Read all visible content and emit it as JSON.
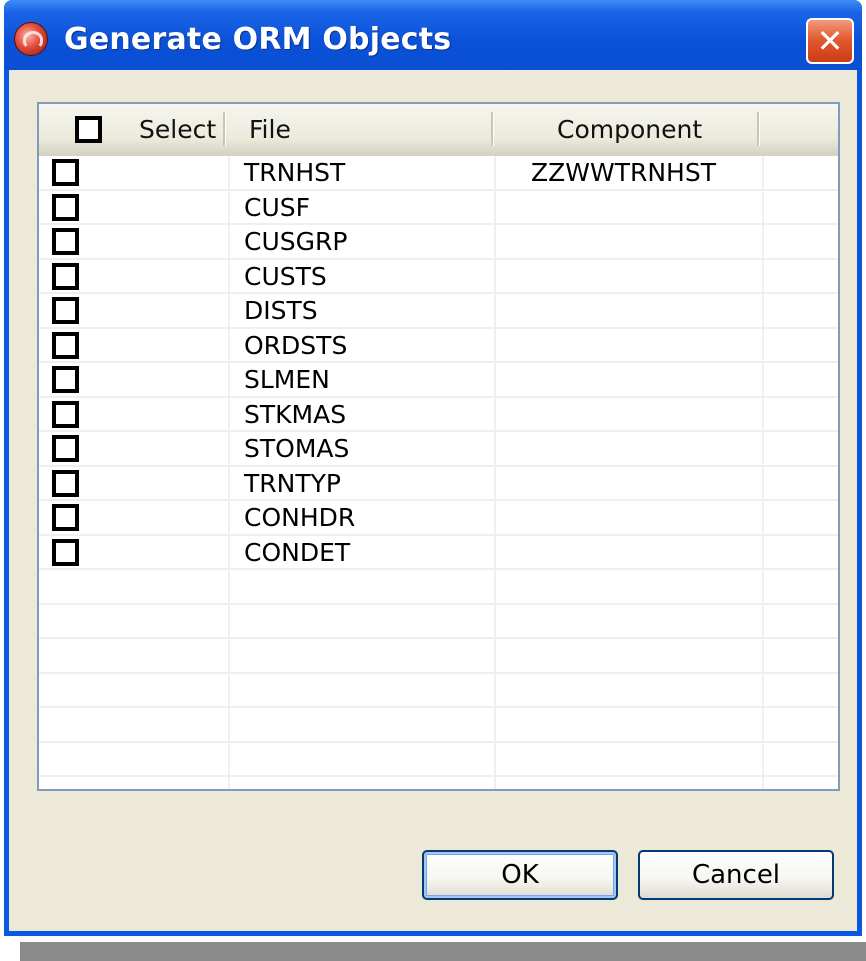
{
  "window": {
    "title": "Generate ORM Objects",
    "close_symbol": "✕"
  },
  "table": {
    "columns": {
      "select": "Select",
      "file": "File",
      "component": "Component"
    },
    "rows": [
      {
        "file": "TRNHST",
        "component": "ZZWWTRNHST",
        "checked": false
      },
      {
        "file": "CUSF",
        "component": "",
        "checked": false
      },
      {
        "file": "CUSGRP",
        "component": "",
        "checked": false
      },
      {
        "file": "CUSTS",
        "component": "",
        "checked": false
      },
      {
        "file": "DISTS",
        "component": "",
        "checked": false
      },
      {
        "file": "ORDSTS",
        "component": "",
        "checked": false
      },
      {
        "file": "SLMEN",
        "component": "",
        "checked": false
      },
      {
        "file": "STKMAS",
        "component": "",
        "checked": false
      },
      {
        "file": "STOMAS",
        "component": "",
        "checked": false
      },
      {
        "file": "TRNTYP",
        "component": "",
        "checked": false
      },
      {
        "file": "CONHDR",
        "component": "",
        "checked": false
      },
      {
        "file": "CONDET",
        "component": "",
        "checked": false
      }
    ]
  },
  "buttons": {
    "ok": "OK",
    "cancel": "Cancel"
  },
  "colors": {
    "titlebar": "#0a51d8",
    "close_button": "#e25b32",
    "dialog_background": "#ece9d8",
    "table_border": "#7f9db9"
  }
}
